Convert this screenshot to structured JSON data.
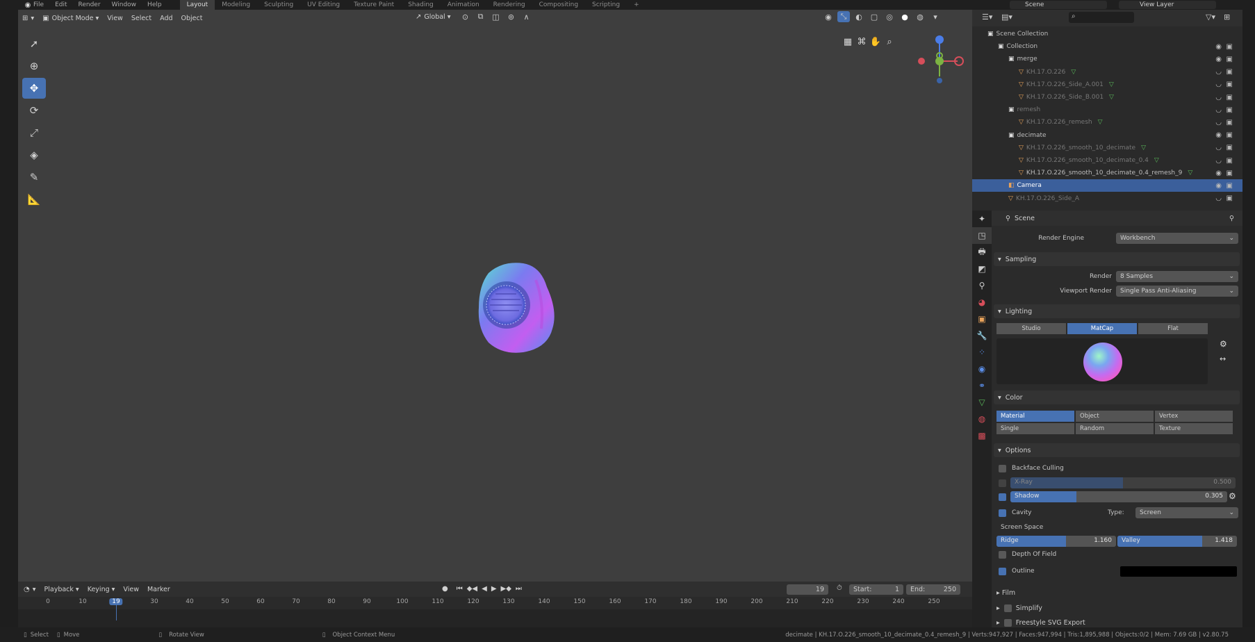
{
  "topbar": {
    "menus": [
      "File",
      "Edit",
      "Render",
      "Window",
      "Help"
    ],
    "workspaces": [
      "Layout",
      "Modeling",
      "Sculpting",
      "UV Editing",
      "Texture Paint",
      "Shading",
      "Animation",
      "Rendering",
      "Compositing",
      "Scripting"
    ],
    "add_workspace": "+",
    "scene": "Scene",
    "view_layer": "View Layer"
  },
  "viewport": {
    "mode": "Object Mode",
    "menus": [
      "View",
      "Select",
      "Add",
      "Object"
    ],
    "orientation": "Global",
    "tools": [
      "cursor-arrow-icon",
      "cursor-icon",
      "move-icon",
      "rotate-icon",
      "scale-icon",
      "transform-icon",
      "annotate-icon",
      "measure-icon"
    ],
    "active_tool_index": 2,
    "gizmo_axes": {
      "y": "Y",
      "z": "Z",
      "x": "X"
    }
  },
  "timeline": {
    "menus": [
      "Playback",
      "Keying",
      "View",
      "Marker"
    ],
    "current_frame": "19",
    "start_label": "Start:",
    "start": "1",
    "end_label": "End:",
    "end": "250",
    "ticks": [
      "0",
      "10",
      "19",
      "30",
      "40",
      "50",
      "60",
      "70",
      "80",
      "90",
      "100",
      "110",
      "120",
      "130",
      "140",
      "150",
      "160",
      "170",
      "180",
      "190",
      "200",
      "210",
      "220",
      "230",
      "240",
      "250"
    ]
  },
  "statusbar": {
    "select": "Select",
    "move": "Move",
    "rotate_view": "Rotate View",
    "context_menu": "Object Context Menu",
    "stats": "decimate | KH.17.O.226_smooth_10_decimate_0.4_remesh_9 | Verts:947,927 | Faces:947,994 | Tris:1,895,988 | Objects:0/2 | Mem: 7.69 GB | v2.80.75"
  },
  "outliner": {
    "rows": [
      {
        "label": "Scene Collection",
        "kind": "collection",
        "depth": 0,
        "dim": false,
        "sel": false
      },
      {
        "label": "Collection",
        "kind": "collection",
        "depth": 1,
        "dim": false,
        "sel": false
      },
      {
        "label": "merge",
        "kind": "collection",
        "depth": 2,
        "dim": false,
        "sel": false
      },
      {
        "label": "KH.17.O.226",
        "kind": "mesh",
        "depth": 3,
        "dim": true,
        "sel": false
      },
      {
        "label": "KH.17.O.226_Side_A.001",
        "kind": "mesh",
        "depth": 3,
        "dim": true,
        "sel": false
      },
      {
        "label": "KH.17.O.226_Side_B.001",
        "kind": "mesh",
        "depth": 3,
        "dim": true,
        "sel": false
      },
      {
        "label": "remesh",
        "kind": "collection",
        "depth": 2,
        "dim": true,
        "sel": false
      },
      {
        "label": "KH.17.O.226_remesh",
        "kind": "mesh",
        "depth": 3,
        "dim": true,
        "sel": false
      },
      {
        "label": "decimate",
        "kind": "collection",
        "depth": 2,
        "dim": false,
        "sel": false
      },
      {
        "label": "KH.17.O.226_smooth_10_decimate",
        "kind": "mesh",
        "depth": 3,
        "dim": true,
        "sel": false
      },
      {
        "label": "KH.17.O.226_smooth_10_decimate_0.4",
        "kind": "mesh",
        "depth": 3,
        "dim": true,
        "sel": false
      },
      {
        "label": "KH.17.O.226_smooth_10_decimate_0.4_remesh_9",
        "kind": "mesh",
        "depth": 3,
        "dim": false,
        "sel": false
      },
      {
        "label": "Camera",
        "kind": "camera",
        "depth": 2,
        "dim": false,
        "sel": true
      },
      {
        "label": "KH.17.O.226_Side_A",
        "kind": "mesh",
        "depth": 2,
        "dim": true,
        "sel": false
      }
    ]
  },
  "properties": {
    "header": "Scene",
    "render_engine_label": "Render Engine",
    "render_engine": "Workbench",
    "sampling": {
      "title": "Sampling",
      "render_label": "Render",
      "render": "8 Samples",
      "viewport_label": "Viewport Render",
      "viewport": "Single Pass Anti-Aliasing"
    },
    "lighting": {
      "title": "Lighting",
      "modes": [
        "Studio",
        "MatCap",
        "Flat"
      ],
      "active": 1
    },
    "color": {
      "title": "Color",
      "options": [
        "Material",
        "Object",
        "Vertex",
        "Single",
        "Random",
        "Texture"
      ],
      "active": 0
    },
    "options": {
      "title": "Options",
      "backface": "Backface Culling",
      "xray": "X-Ray",
      "xray_val": "0.500",
      "xray_fill": 0.5,
      "shadow": "Shadow",
      "shadow_val": "0.305",
      "shadow_fill": 0.305,
      "cavity": "Cavity",
      "type_label": "Type:",
      "type": "Screen",
      "screen_space": "Screen Space",
      "ridge": "Ridge",
      "ridge_val": "1.160",
      "ridge_fill": 0.58,
      "valley": "Valley",
      "valley_val": "1.418",
      "valley_fill": 0.71,
      "dof": "Depth Of Field",
      "outline": "Outline"
    },
    "film": "Film",
    "simplify": "Simplify",
    "freestyle": "Freestyle SVG Export"
  }
}
